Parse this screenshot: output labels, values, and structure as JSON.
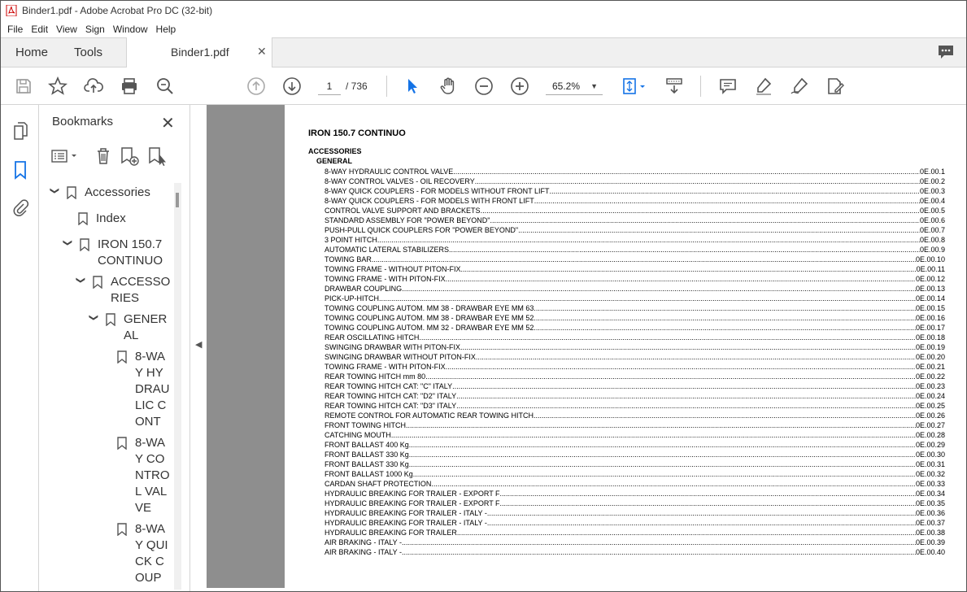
{
  "window": {
    "title": "Binder1.pdf - Adobe Acrobat Pro DC (32-bit)"
  },
  "menu": [
    "File",
    "Edit",
    "View",
    "Sign",
    "Window",
    "Help"
  ],
  "tabs": {
    "home": "Home",
    "tools": "Tools",
    "document": "Binder1.pdf"
  },
  "toolbar": {
    "page_current": "1",
    "page_total": "/ 736",
    "zoom": "65.2%"
  },
  "bookmarks": {
    "title": "Bookmarks",
    "items": [
      {
        "label": "Accessories"
      },
      {
        "label": "Index"
      },
      {
        "label": "IRON 150.7 CONTINUO"
      },
      {
        "label": "ACCESSORIES"
      },
      {
        "label": "GENERAL"
      },
      {
        "label": "8-WAY HYDRAULIC CONT"
      },
      {
        "label": "8-WAY CONTROL VALVE"
      },
      {
        "label": "8-WAY QUICK COUP"
      }
    ]
  },
  "document": {
    "title": "IRON 150.7 CONTINUO",
    "section": "ACCESSORIES",
    "subsection": "GENERAL",
    "entries": [
      {
        "text": "8-WAY HYDRAULIC CONTROL VALVE",
        "page": "0E.00.1"
      },
      {
        "text": "8-WAY CONTROL VALVES - OIL RECOVERY",
        "page": "0E.00.2"
      },
      {
        "text": "8-WAY QUICK COUPLERS - FOR MODELS WITHOUT FRONT LIFT",
        "page": "0E.00.3"
      },
      {
        "text": "8-WAY QUICK COUPLERS - FOR MODELS WITH FRONT LIFT",
        "page": "0E.00.4"
      },
      {
        "text": "CONTROL VALVE SUPPORT AND BRACKETS",
        "page": "0E.00.5"
      },
      {
        "text": "STANDARD ASSEMBLY FOR \"POWER BEYOND\"",
        "page": "0E.00.6"
      },
      {
        "text": "PUSH-PULL QUICK COUPLERS FOR \"POWER BEYOND\"",
        "page": "0E.00.7"
      },
      {
        "text": "3 POINT HITCH",
        "page": "0E.00.8"
      },
      {
        "text": "AUTOMATIC LATERAL STABILIZERS",
        "page": "0E.00.9"
      },
      {
        "text": "TOWING BAR",
        "page": "0E.00.10"
      },
      {
        "text": "TOWING FRAME - WITHOUT PITON-FIX",
        "page": "0E.00.11"
      },
      {
        "text": "TOWING FRAME - WITH PITON-FIX",
        "page": "0E.00.12"
      },
      {
        "text": "DRAWBAR COUPLING",
        "page": "0E.00.13"
      },
      {
        "text": "PICK-UP-HITCH",
        "page": "0E.00.14"
      },
      {
        "text": "TOWING COUPLING AUTOM. MM 38 - DRAWBAR EYE MM 63",
        "page": "0E.00.15"
      },
      {
        "text": "TOWING COUPLING AUTOM. MM 38 - DRAWBAR EYE MM 52",
        "page": "0E.00.16"
      },
      {
        "text": "TOWING COUPLING AUTOM. MM 32 - DRAWBAR EYE MM 52",
        "page": "0E.00.17"
      },
      {
        "text": "REAR OSCILLATING HITCH",
        "page": "0E.00.18"
      },
      {
        "text": "SWINGING DRAWBAR WITH PITON-FIX",
        "page": "0E.00.19"
      },
      {
        "text": "SWINGING DRAWBAR WITHOUT PITON-FIX",
        "page": "0E.00.20"
      },
      {
        "text": "TOWING FRAME - WITH PITON-FIX",
        "page": "0E.00.21"
      },
      {
        "text": "REAR TOWING HITCH mm 80",
        "page": "0E.00.22"
      },
      {
        "text": "REAR TOWING HITCH CAT: \"C\" ITALY",
        "page": "0E.00.23"
      },
      {
        "text": "REAR TOWING HITCH CAT: \"D2\" ITALY",
        "page": "0E.00.24"
      },
      {
        "text": "REAR TOWING HITCH CAT: \"D3\" ITALY",
        "page": "0E.00.25"
      },
      {
        "text": "REMOTE CONTROL FOR AUTOMATIC REAR TOWING HITCH",
        "page": "0E.00.26"
      },
      {
        "text": "FRONT TOWING HITCH",
        "page": "0E.00.27"
      },
      {
        "text": "CATCHING MOUTH",
        "page": "0E.00.28"
      },
      {
        "text": "FRONT BALLAST 400 Kg",
        "page": "0E.00.29"
      },
      {
        "text": "FRONT BALLAST 330 Kg",
        "page": "0E.00.30"
      },
      {
        "text": "FRONT BALLAST 330 Kg",
        "page": "0E.00.31"
      },
      {
        "text": "FRONT BALLAST 1000 Kg",
        "page": "0E.00.32"
      },
      {
        "text": "CARDAN SHAFT PROTECTION",
        "page": "0E.00.33"
      },
      {
        "text": "HYDRAULIC BREAKING FOR TRAILER - EXPORT F",
        "page": "0E.00.34"
      },
      {
        "text": "HYDRAULIC BREAKING FOR TRAILER - EXPORT F",
        "page": "0E.00.35"
      },
      {
        "text": "HYDRAULIC BREAKING FOR TRAILER - ITALY -",
        "page": "0E.00.36"
      },
      {
        "text": "HYDRAULIC BREAKING FOR TRAILER - ITALY -",
        "page": "0E.00.37"
      },
      {
        "text": "HYDRAULIC BREAKING FOR TRAILER",
        "page": "0E.00.38"
      },
      {
        "text": "AIR BRAKING - ITALY -",
        "page": "0E.00.39"
      },
      {
        "text": "AIR BRAKING - ITALY -",
        "page": "0E.00.40"
      }
    ]
  },
  "icons": {
    "rail": [
      "pages-icon",
      "bookmark-icon",
      "attachment-icon"
    ],
    "accent": "#1473e6"
  }
}
